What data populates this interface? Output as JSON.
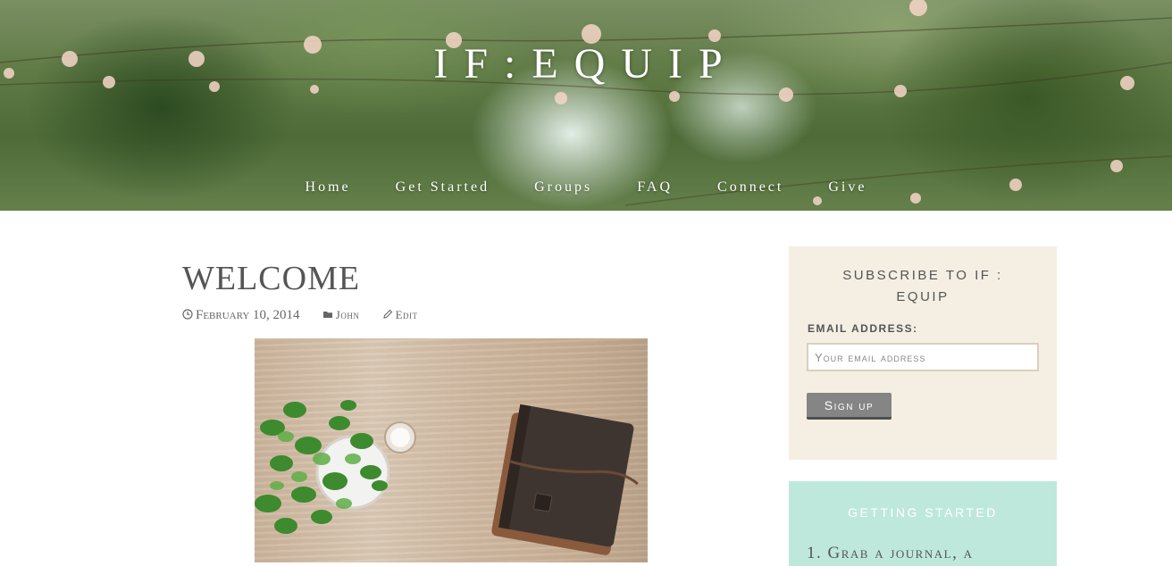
{
  "header": {
    "site_title": "IF:EQUIP",
    "nav": [
      "Home",
      "Get Started",
      "Groups",
      "FAQ",
      "Connect",
      "Give"
    ]
  },
  "post": {
    "title": "WELCOME",
    "date": "February 10, 2014",
    "author": "John",
    "edit_label": "Edit",
    "image_icon_names": [
      "clock-icon",
      "folder-icon",
      "pencil-icon"
    ]
  },
  "sidebar": {
    "subscribe": {
      "title": "SUBSCRIBE TO IF : EQUIP",
      "email_label": "EMAIL ADDRESS:",
      "email_placeholder": "Your email address",
      "button_label": "Sign up"
    },
    "getting_started": {
      "title": "GETTING STARTED",
      "first_item": "1. Grab a journal, a"
    }
  },
  "colors": {
    "subscribe_bg": "#f4efe2",
    "getting_started_bg": "#bfe8dc",
    "button_bg": "#858585"
  }
}
